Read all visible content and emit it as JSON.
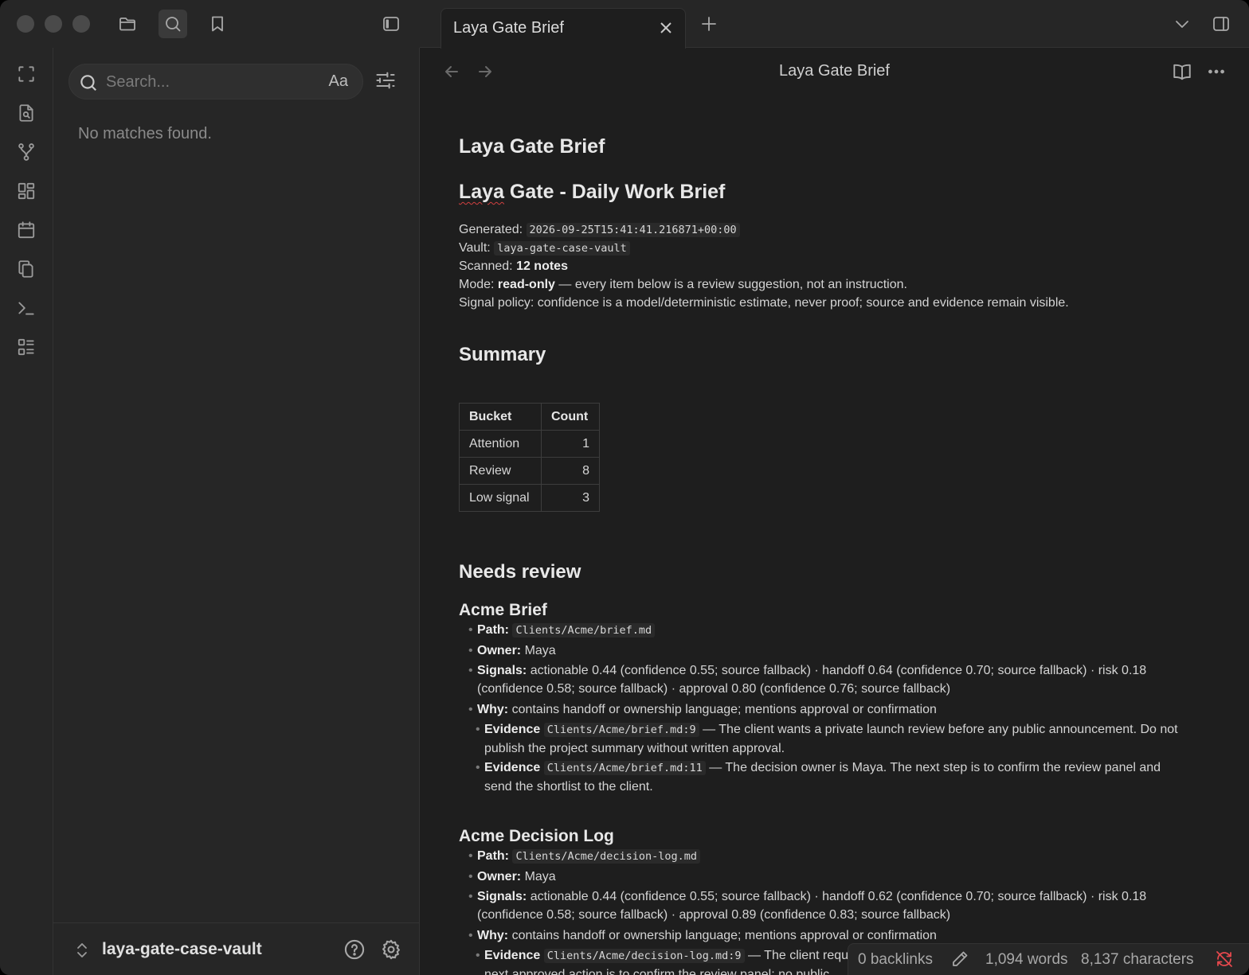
{
  "window": {
    "tab_title": "Laya Gate Brief"
  },
  "sidebar": {
    "search_placeholder": "Search...",
    "match_case_label": "Aa",
    "no_matches": "No matches found.",
    "vault_name": "laya-gate-case-vault"
  },
  "view": {
    "title": "Laya Gate Brief"
  },
  "note": {
    "title": "Laya Gate Brief",
    "heading_part1": "Laya",
    "heading_part2": " Gate - Daily Work Brief",
    "generated_label": "Generated:",
    "generated_value": "2026-09-25T15:41:41.216871+00:00",
    "vault_label": "Vault:",
    "vault_value": "laya-gate-case-vault",
    "scanned_label": "Scanned:",
    "scanned_value": "12 notes",
    "mode_label": "Mode:",
    "mode_value": "read-only",
    "mode_rest": "— every item below is a review suggestion, not an instruction.",
    "signal_policy": "Signal policy: confidence is a model/deterministic estimate, never proof; source and evidence remain visible.",
    "summary_heading": "Summary",
    "summary_table": {
      "headers": [
        "Bucket",
        "Count"
      ],
      "rows": [
        [
          "Attention",
          "1"
        ],
        [
          "Review",
          "8"
        ],
        [
          "Low signal",
          "3"
        ]
      ]
    },
    "needs_review_heading": "Needs review",
    "items": [
      {
        "title": "Acme Brief",
        "path_label": "Path:",
        "path": "Clients/Acme/brief.md",
        "owner_label": "Owner:",
        "owner": "Maya",
        "signals_label": "Signals:",
        "signals_line1": "actionable 0.44 (confidence 0.55; source fallback) · handoff 0.64 (confidence 0.70; source fallback) · risk 0.18",
        "signals_line2": "(confidence 0.58; source fallback) · approval 0.80 (confidence 0.76; source fallback)",
        "why_label": "Why:",
        "why": "contains handoff or ownership language; mentions approval or confirmation",
        "evidence_label": "Evidence",
        "evidence": [
          {
            "ref": "Clients/Acme/brief.md:9",
            "line1": "— The client wants a private launch review before any public announcement. Do not",
            "line2": "publish the project summary without written approval."
          },
          {
            "ref": "Clients/Acme/brief.md:11",
            "line1": "— The decision owner is Maya. The next step is to confirm the review panel and",
            "line2": "send the shortlist to the client."
          }
        ]
      },
      {
        "title": "Acme Decision Log",
        "path_label": "Path:",
        "path": "Clients/Acme/decision-log.md",
        "owner_label": "Owner:",
        "owner": "Maya",
        "signals_label": "Signals:",
        "signals_line1": "actionable 0.44 (confidence 0.55; source fallback) · handoff 0.62 (confidence 0.70; source fallback) · risk 0.18",
        "signals_line2": "(confidence 0.58; source fallback) · approval 0.89 (confidence 0.83; source fallback)",
        "why_label": "Why:",
        "why": "contains handoff or ownership language; mentions approval or confirmation",
        "evidence_label": "Evidence",
        "evidence": [
          {
            "ref": "Clients/Acme/decision-log.md:9",
            "line1": "— The client requ",
            "line2": "next approved action is to confirm the review panel; no public"
          }
        ]
      }
    ]
  },
  "status": {
    "backlinks": "0 backlinks",
    "words": "1,094 words",
    "characters": "8,137 characters",
    "sync_color": "#e5484d"
  }
}
